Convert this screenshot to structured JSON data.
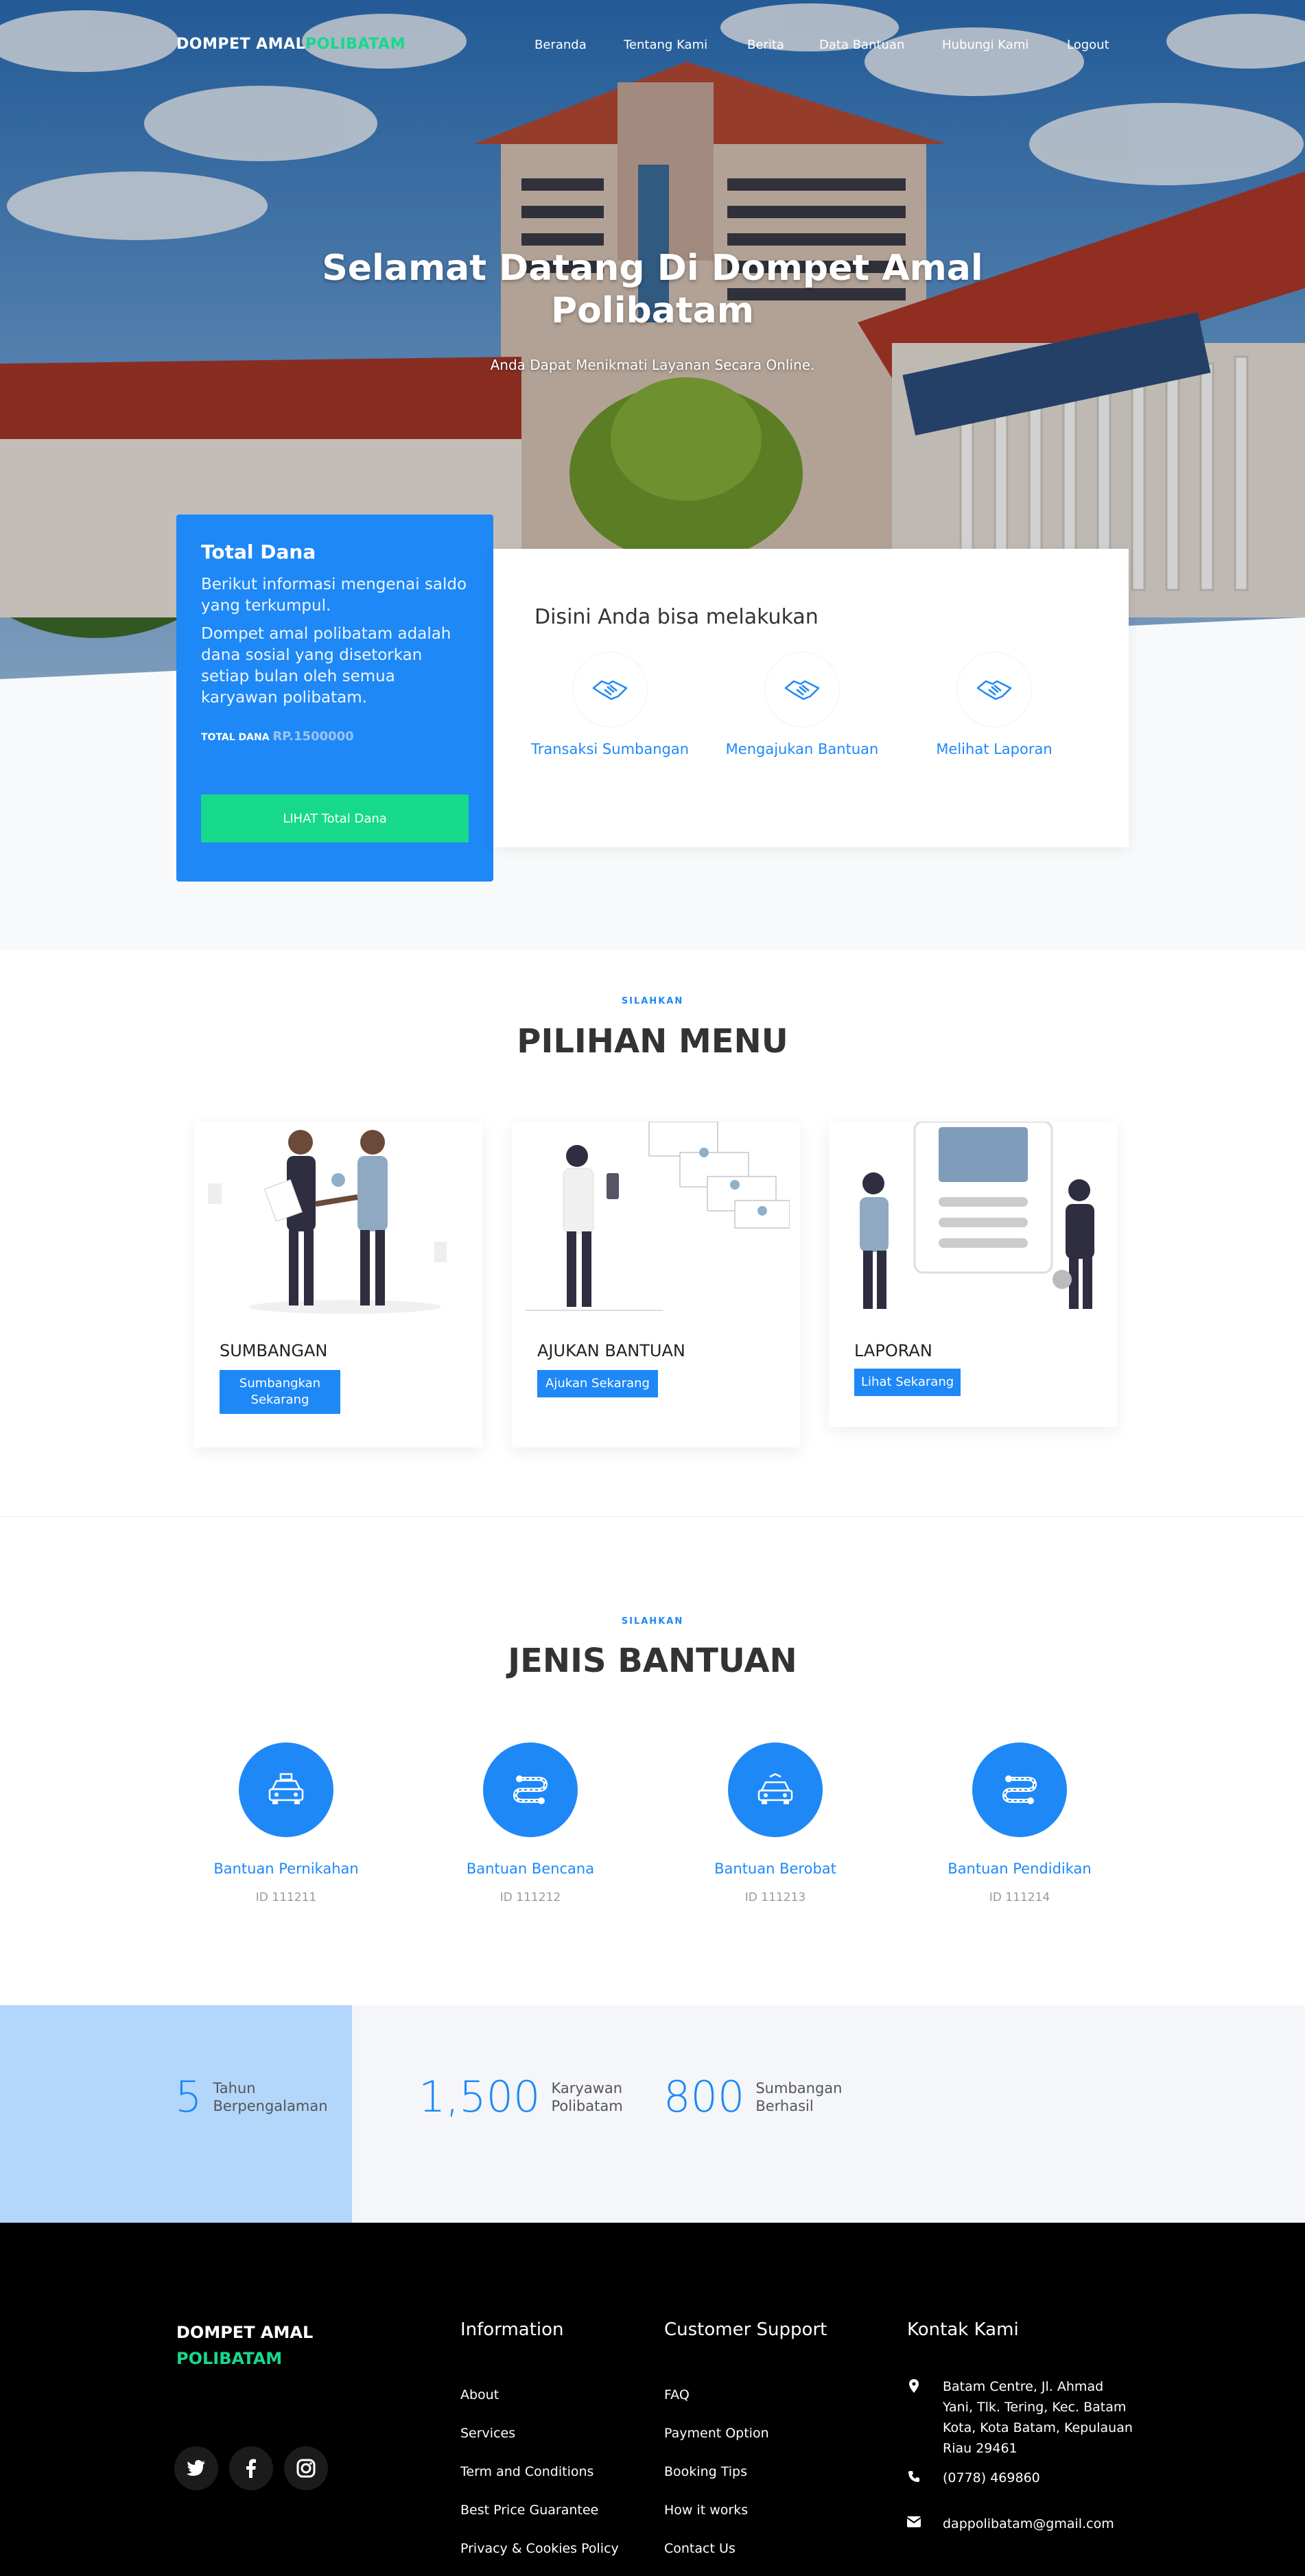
{
  "brand": {
    "part1": "DOMPET AMAL",
    "part2": "POLIBATAM"
  },
  "nav": {
    "items": [
      "Beranda",
      "Tentang Kami",
      "Berita",
      "Data Bantuan",
      "Hubungi Kami",
      "Logout"
    ]
  },
  "hero": {
    "title": "Selamat Datang Di Dompet Amal Polibatam",
    "subtitle": "Anda Dapat Menikmati Layanan Secara Online."
  },
  "fund": {
    "title": "Total Dana",
    "desc1": "Berikut informasi mengenai saldo yang terkumpul.",
    "desc2": "Dompet amal polibatam adalah dana sosial yang disetorkan setiap bulan oleh semua karyawan polibatam.",
    "total_label": "TOTAL DANA",
    "total_value": "RP.1500000",
    "button": "LIHAT Total Dana"
  },
  "actions": {
    "title": "Disini Anda bisa melakukan",
    "items": [
      {
        "label": "Transaksi Sumbangan",
        "icon": "handshake-icon"
      },
      {
        "label": "Mengajukan Bantuan",
        "icon": "handshake-icon"
      },
      {
        "label": "Melihat Laporan",
        "icon": "handshake-icon"
      }
    ]
  },
  "menu": {
    "kicker": "SILAHKAN",
    "title": "PILIHAN MENU",
    "cards": [
      {
        "title": "SUMBANGAN",
        "button": "Sumbangkan Sekarang"
      },
      {
        "title": "AJUKAN BANTUAN",
        "button": "Ajukan Sekarang"
      },
      {
        "title": "LAPORAN",
        "button": "Lihat Sekarang"
      }
    ]
  },
  "jenis": {
    "kicker": "SILAHKAN",
    "title": "JENIS BANTUAN",
    "items": [
      {
        "name": "Bantuan Pernikahan",
        "id": "ID 111211",
        "icon": "taxi-icon"
      },
      {
        "name": "Bantuan Bencana",
        "id": "ID 111212",
        "icon": "route-icon"
      },
      {
        "name": "Bantuan Berobat",
        "id": "ID 111213",
        "icon": "car-icon"
      },
      {
        "name": "Bantuan Pendidikan",
        "id": "ID 111214",
        "icon": "route-icon"
      }
    ]
  },
  "stats": [
    {
      "num": "5",
      "line1": "Tahun",
      "line2": "Berpengalaman"
    },
    {
      "num": "1,500",
      "line1": "Karyawan",
      "line2": "Polibatam"
    },
    {
      "num": "800",
      "line1": "Sumbangan",
      "line2": "Berhasil"
    }
  ],
  "footer": {
    "brand1": "DOMPET AMAL",
    "brand2": "POLIBATAM",
    "info_title": "Information",
    "info_links": [
      "About",
      "Services",
      "Term and Conditions",
      "Best Price Guarantee",
      "Privacy & Cookies Policy"
    ],
    "support_title": "Customer Support",
    "support_links": [
      "FAQ",
      "Payment Option",
      "Booking Tips",
      "How it works",
      "Contact Us"
    ],
    "contact_title": "Kontak Kami",
    "address": "Batam Centre, Jl. Ahmad Yani, Tlk. Tering, Kec. Batam Kota, Kota Batam, Kepulauan Riau 29461",
    "phone": "(0778) 469860",
    "email": "dappolibatam@gmail.com",
    "social": [
      "twitter-icon",
      "facebook-icon",
      "instagram-icon"
    ]
  },
  "colors": {
    "primary": "#1e88f7",
    "accent": "#16d98b",
    "footer": "#000000"
  }
}
